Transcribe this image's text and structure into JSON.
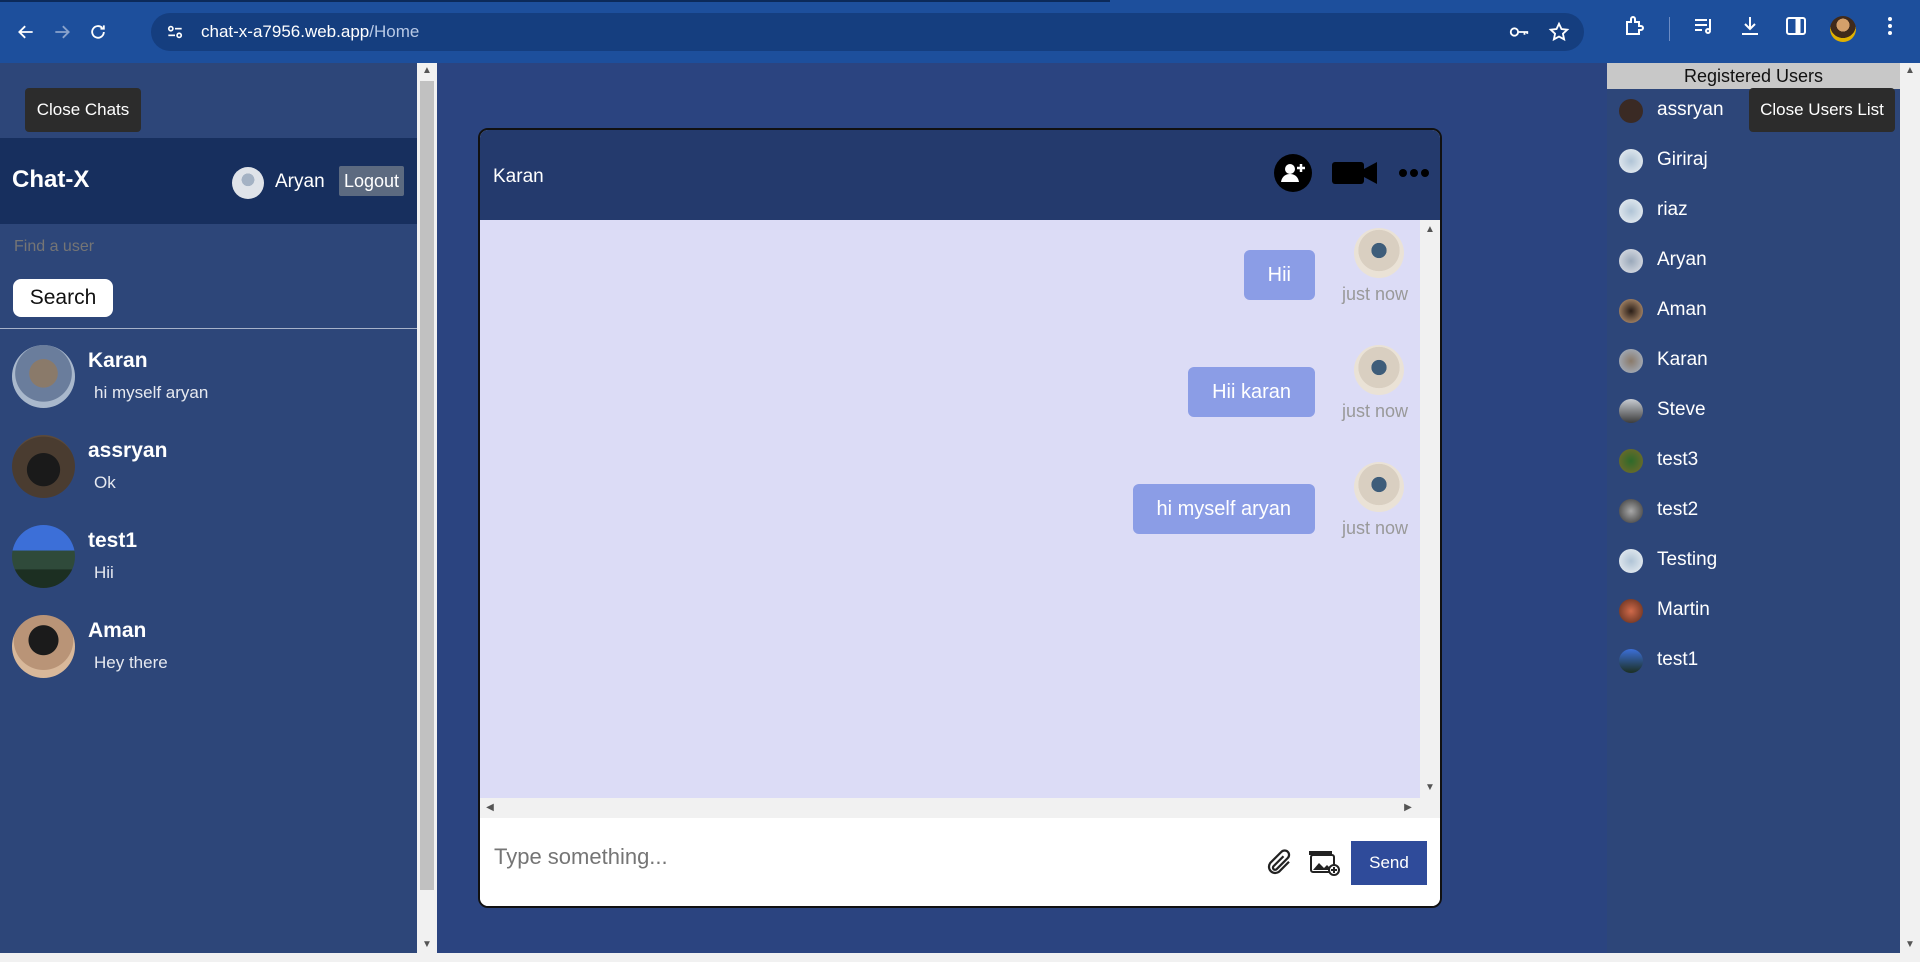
{
  "browser": {
    "url_domain": "chat-x-a7956.web.app",
    "url_path": "/Home"
  },
  "left": {
    "close_chats_label": "Close Chats",
    "brand": "Chat-X",
    "me_name": "Aryan",
    "logout_label": "Logout",
    "find_placeholder": "Find a user",
    "search_label": "Search",
    "chats": [
      {
        "name": "Karan",
        "last": "hi myself aryan"
      },
      {
        "name": "assryan",
        "last": "Ok"
      },
      {
        "name": "test1",
        "last": "Hii"
      },
      {
        "name": "Aman",
        "last": "Hey there"
      }
    ]
  },
  "chat": {
    "title": "Karan",
    "messages": [
      {
        "text": "Hii",
        "time": "just now"
      },
      {
        "text": "Hii karan",
        "time": "just now"
      },
      {
        "text": "hi myself aryan",
        "time": "just now"
      }
    ],
    "input_placeholder": "Type something...",
    "send_label": "Send"
  },
  "right": {
    "title": "Registered Users",
    "close_users_label": "Close Users List",
    "users": [
      "assryan",
      "Giriraj",
      "riaz",
      "Aryan",
      "Aman",
      "Karan",
      "Steve",
      "test3",
      "test2",
      "Testing",
      "Martin",
      "test1"
    ]
  },
  "colors": {
    "sidebar_bg": "#2d4679",
    "header_bg": "#172f5e",
    "chat_bg": "#dcdcf6",
    "bubble": "#8b9de6",
    "send_button": "#2f4b9a"
  }
}
